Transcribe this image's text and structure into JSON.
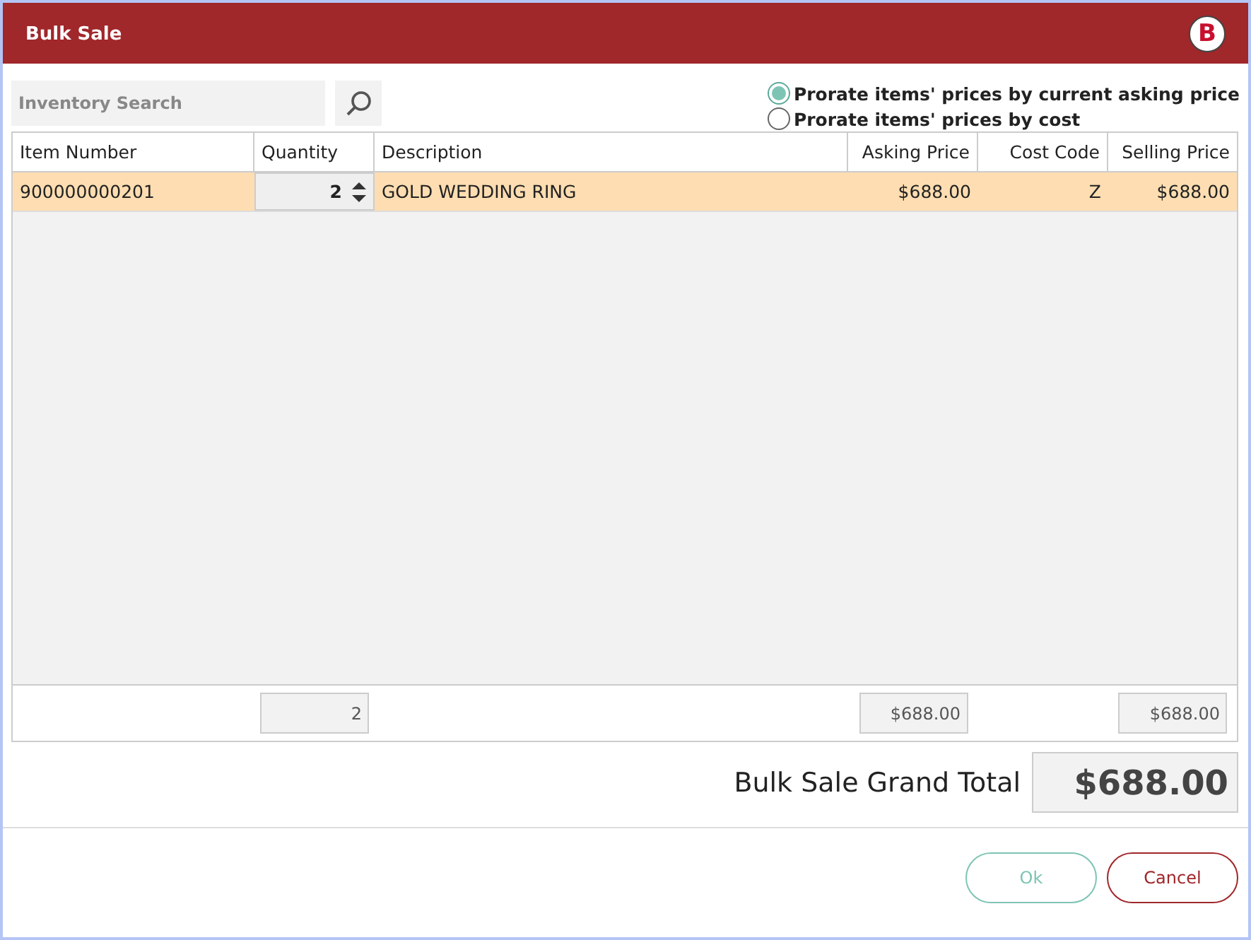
{
  "window": {
    "title": "Bulk Sale",
    "logo": "B"
  },
  "search": {
    "placeholder": "Inventory Search"
  },
  "prorate_options": [
    {
      "label": "Prorate items' prices by current asking price",
      "selected": true
    },
    {
      "label": "Prorate items' prices by cost",
      "selected": false
    }
  ],
  "table": {
    "columns": [
      "Item Number",
      "Quantity",
      "Description",
      "Asking Price",
      "Cost Code",
      "Selling Price"
    ],
    "rows": [
      {
        "selected": true,
        "cells": [
          "900000000201",
          "2",
          "GOLD WEDDING RING",
          "$688.00",
          "Z",
          "$688.00"
        ]
      }
    ],
    "totals": {
      "quantity": "2",
      "asking_price": "$688.00",
      "selling_price": "$688.00"
    }
  },
  "grand_total": {
    "label": "Bulk Sale Grand Total",
    "value": "$688.00"
  },
  "buttons": [
    {
      "label": "Ok",
      "kind": "ok"
    },
    {
      "label": "Cancel",
      "kind": "cancel"
    }
  ]
}
